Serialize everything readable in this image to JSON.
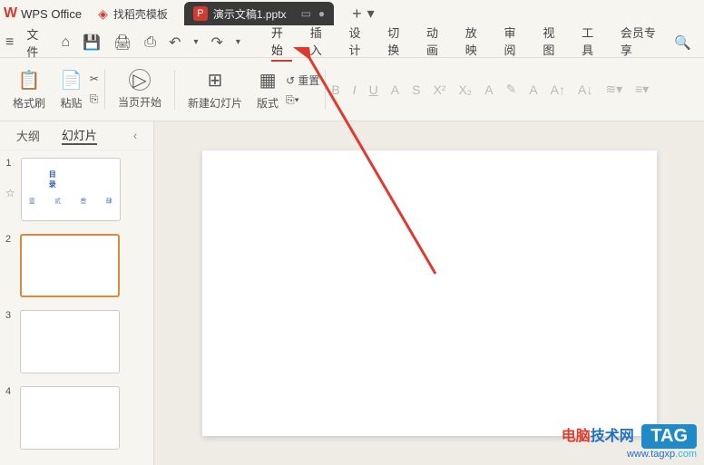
{
  "app": {
    "name": "WPS Office",
    "logo": "W"
  },
  "tabs": {
    "template": {
      "icon": "◈",
      "label": "找稻壳模板"
    },
    "active": {
      "icon": "P",
      "label": "演示文稿1.pptx"
    },
    "add": "+",
    "dropdown": "▾",
    "window_mode": "▭",
    "dot": "●"
  },
  "menubar": {
    "menu_icon": "≡",
    "file": "文件",
    "icons": {
      "home": "⌂",
      "save": "💾",
      "print": "🖨",
      "preview": "⎙",
      "undo": "↶",
      "undo_drop": "▾",
      "redo": "↷",
      "redo_drop": "▾"
    }
  },
  "ribbon": {
    "tabs": [
      "开始",
      "插入",
      "设计",
      "切换",
      "动画",
      "放映",
      "审阅",
      "视图",
      "工具",
      "会员专享"
    ],
    "selected_index": 0,
    "search": "🔍"
  },
  "toolbar": {
    "format_brush": {
      "icon": "📋",
      "label": "格式刷"
    },
    "paste": {
      "icon": "📄",
      "label": "粘贴"
    },
    "cut": "✂",
    "copy": "⎘",
    "play": "▷",
    "from_current": "当页开始",
    "new_slide": {
      "icon": "⊞",
      "label": "新建幻灯片"
    },
    "layout": {
      "icon": "▦",
      "label": "版式"
    },
    "section": "⎘▾",
    "reset": "↺ 重置",
    "font_tools": {
      "bold": "B",
      "italic": "I",
      "underline": "U",
      "strike": "A",
      "strike2": "S",
      "super": "X²",
      "sub": "X₂",
      "font_color": "A",
      "highlight": "✎",
      "clear": "A",
      "increase": "A↑",
      "decrease": "A↓",
      "effects": "≋▾",
      "list": "≡▾"
    }
  },
  "side_panel": {
    "tabs": {
      "outline": "大纲",
      "slides": "幻灯片"
    },
    "collapse": "‹",
    "star": "☆",
    "thumbs": [
      {
        "num": "1",
        "type": "title",
        "title": "目 录",
        "subs": [
          "壹",
          "贰",
          "叁",
          "肆"
        ]
      },
      {
        "num": "2",
        "type": "blank"
      },
      {
        "num": "3",
        "type": "blank"
      },
      {
        "num": "4",
        "type": "blank"
      }
    ],
    "selected": 1
  },
  "watermark": {
    "site_red": "电脑",
    "site_blue": "技术网",
    "tag": "TAG",
    "url_prefix": "www.",
    "url_main": "tagxp",
    "url_ext": ".com"
  }
}
